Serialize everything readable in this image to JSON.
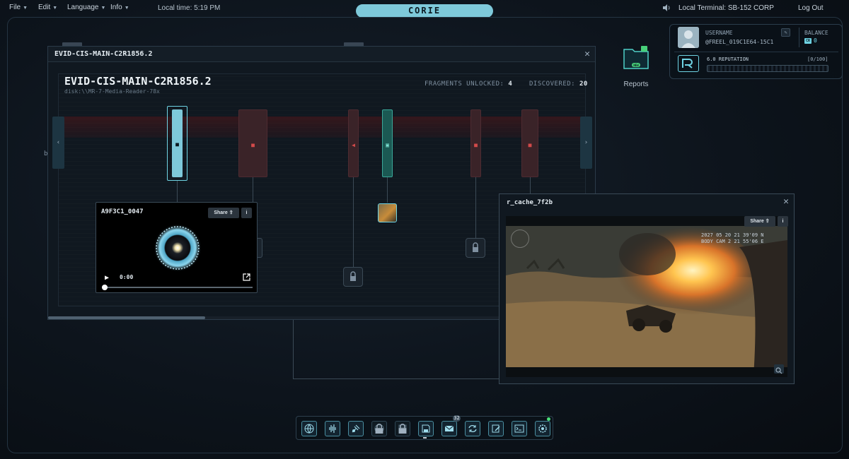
{
  "menu": {
    "file": "File",
    "edit": "Edit",
    "language": "Language",
    "info": "Info",
    "local_time": "Local time: 5:19 PM"
  },
  "logo": "CORIE",
  "terminal": "Local Terminal: SB-152 CORP",
  "logout": "Log Out",
  "user": {
    "username_label": "USERNAME",
    "username": "@FREEL_019C1E64-15C1",
    "balance_label": "BALANCE",
    "balance_badge": "CR",
    "balance": "0",
    "reputation_label": "6.0 REPUTATION",
    "reputation_count": "[0/100]"
  },
  "desktop": {
    "reports_label": "Reports",
    "reports_badge": "NEW"
  },
  "evidence_window": {
    "title": "EVID-CIS-MAIN-C2R1856.2",
    "heading": "EVID-CIS-MAIN-C2R1856.2",
    "disk": "disk:\\\\MR-7-Media-Reader-78x",
    "fragments_label": "FRAGMENTS UNLOCKED:",
    "fragments_value": "4",
    "discovered_label": "DISCOVERED:",
    "discovered_value": "20",
    "prev_arrow": "‹",
    "next_arrow": "›",
    "fragments_unlocked_ratio": 0.2,
    "scroll_position": 0.29
  },
  "player": {
    "title": "A9F3C1_0047",
    "share_label": "Share",
    "info_label": "i",
    "time": "0:00",
    "progress": 0
  },
  "cache_window": {
    "title": "r_cache_7f2b",
    "share_label": "Share",
    "info_label": "i",
    "overlay_line1": "2027 05 20 21 39'09 N",
    "overlay_line2": "BODY CAM 2 21 55'06 E"
  },
  "dock": {
    "mail_count": "32",
    "icons": [
      "globe-icon",
      "audio-wave-icon",
      "satellite-icon",
      "network-icon",
      "document-icon",
      "save-icon",
      "mail-icon",
      "sync-icon",
      "notes-icon",
      "terminal-icon",
      "settings-icon"
    ]
  },
  "colors": {
    "accent": "#6fd4e4",
    "fragment_locked": "#3a2328",
    "online": "#4be07a"
  }
}
